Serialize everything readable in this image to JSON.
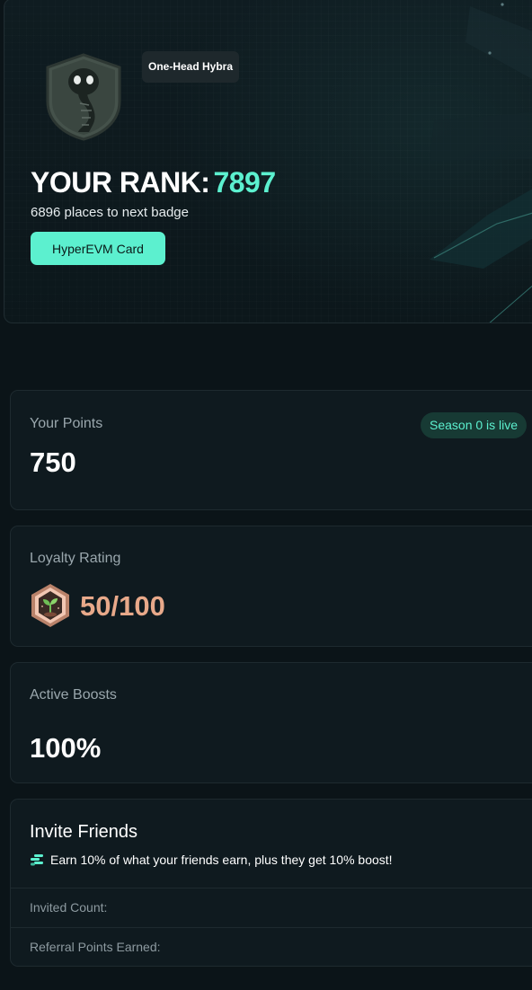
{
  "rank_card": {
    "badge_name": "One-Head Hybra",
    "rank_label": "YOUR RANK:",
    "rank_value": "7897",
    "places_text": "6896 places to next badge",
    "card_button_label": "HyperEVM Card",
    "badge_icon": "cobra-shield-icon"
  },
  "points": {
    "label": "Your Points",
    "value": "750",
    "season_label": "Season 0 is live"
  },
  "loyalty": {
    "label": "Loyalty Rating",
    "value": "50/100",
    "icon": "sprout-hexagon-icon"
  },
  "boosts": {
    "label": "Active Boosts",
    "value": "100%"
  },
  "invite": {
    "title": "Invite Friends",
    "description": "Earn 10% of what your friends earn, plus they get 10% boost!",
    "icon": "coins-stack-icon",
    "invited_count_label": "Invited Count:",
    "referral_points_label": "Referral Points Earned:"
  },
  "colors": {
    "accent": "#5cf0cf",
    "background": "#0b1418",
    "card": "#0f1a1f",
    "loyalty": "#e8a98a"
  }
}
